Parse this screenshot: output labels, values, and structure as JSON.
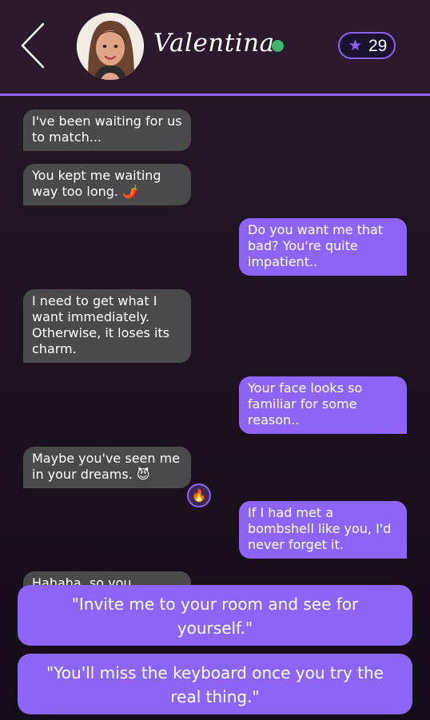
{
  "header": {
    "name": "Valentina",
    "online": true,
    "points": "29"
  },
  "colors": {
    "accent": "#8c64f6",
    "incoming_bubble": "#4a4a4c",
    "online": "#3fb66b"
  },
  "messages": [
    {
      "from": "them",
      "text": "I've been waiting for us to match..."
    },
    {
      "from": "them",
      "text": "You kept me waiting way too long. 🌶️"
    },
    {
      "from": "me",
      "text": "Do you want me that bad? You're quite impatient.."
    },
    {
      "from": "them",
      "text": "I need to get what I want immediately. Otherwise, it loses its charm."
    },
    {
      "from": "me",
      "text": "Your face looks so familiar for some reason.."
    },
    {
      "from": "them",
      "text": "Maybe you've seen me in your dreams. 😈",
      "reaction": "🔥"
    },
    {
      "from": "me",
      "text": "If I had met a bombshell like you, I'd never forget it."
    },
    {
      "from": "them",
      "text": "Hahaha, so you"
    }
  ],
  "replies": [
    "\"Invite me to your room and see for yourself.\"",
    "\"You'll miss the keyboard once you try the real thing.\""
  ]
}
